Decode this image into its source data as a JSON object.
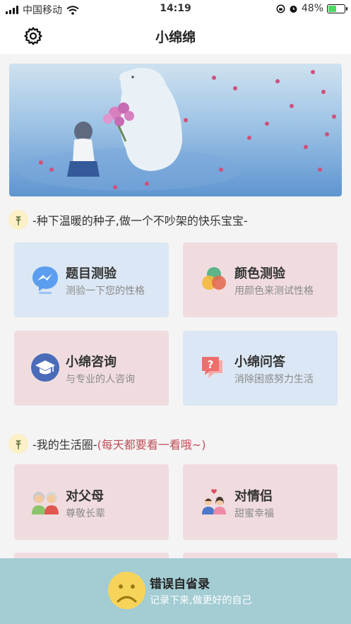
{
  "status_bar": {
    "carrier": "中国移动",
    "time": "14:19",
    "battery": "48%"
  },
  "nav": {
    "title": "小绵绵"
  },
  "section1": {
    "text": "-种下温暖的种子,做一个不吵架的快乐宝宝-"
  },
  "cards_top": [
    {
      "title": "题目测验",
      "subtitle": "测验一下您的性格",
      "icon": "messenger-bubble-icon",
      "color": "#dbe7f4"
    },
    {
      "title": "颜色测验",
      "subtitle": "用颜色来测试性格",
      "icon": "color-circles-icon",
      "color": "#f0dcdf"
    },
    {
      "title": "小绵咨询",
      "subtitle": "与专业的人咨询",
      "icon": "graduation-cap-icon",
      "color": "#f0dcdf"
    },
    {
      "title": "小绵问答",
      "subtitle": "消除困惑努力生活",
      "icon": "question-bubble-icon",
      "color": "#dbe7f4"
    }
  ],
  "section2": {
    "text": "-我的生活圈-",
    "highlight": "(每天都要看一看哦~)"
  },
  "cards_life": [
    {
      "title": "对父母",
      "subtitle": "尊敬长辈",
      "icon": "elderly-couple-icon"
    },
    {
      "title": "对情侣",
      "subtitle": "甜蜜幸福",
      "icon": "couple-heart-icon"
    }
  ],
  "bottom": {
    "title": "错误自省录",
    "subtitle": "记录下来,做更好的自己",
    "icon": "sad-face-icon"
  }
}
